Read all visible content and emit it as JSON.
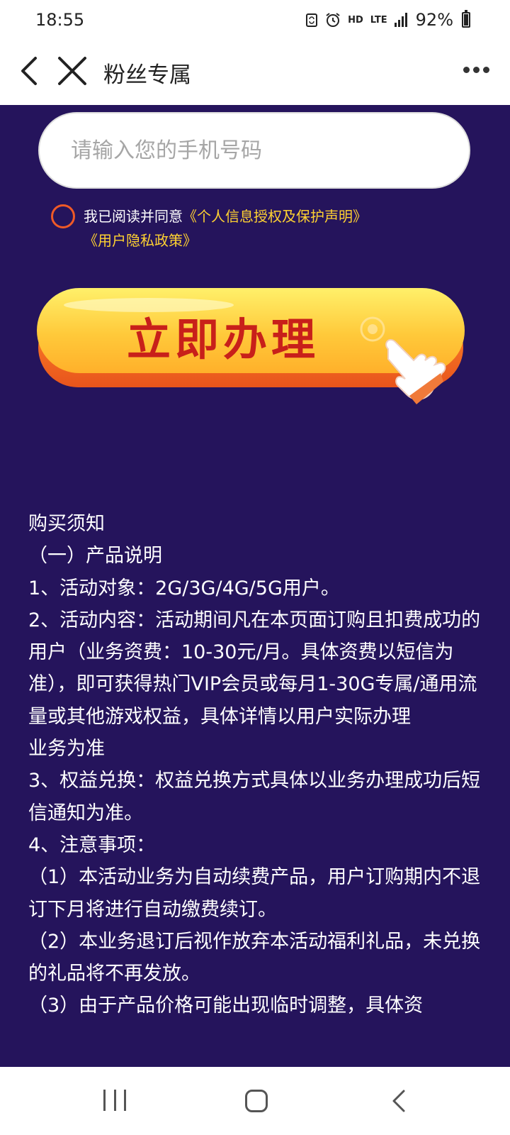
{
  "status_bar": {
    "time": "18:55",
    "network_label": "HD",
    "lte_label": "LTE",
    "battery_percent": "92%"
  },
  "nav": {
    "title": "粉丝专属",
    "icons": [
      "back-arrow-icon",
      "close-icon",
      "more-dots-icon"
    ]
  },
  "form": {
    "phone_placeholder": "请输入您的手机号码",
    "agreement": {
      "prefix": "我已阅读并同意",
      "link1": "《个人信息授权及保护声明》",
      "link2": "《用户隐私政策》",
      "checked": false
    },
    "cta_label": "立即办理"
  },
  "notice": {
    "lines": [
      "购买须知",
      "（一）产品说明",
      "1、活动对象：2G/3G/4G/5G用户。",
      "2、活动内容：活动期间凡在本页面订购且扣费成功的用户（业务资费：10-30元/月。具体资费以短信为准），即可获得热门VIP会员或每月1-30G专属/通用流量或其他游戏权益，具体详情以用户实际办理",
      "业务为准",
      "3、权益兑换：权益兑换方式具体以业务办理成功后短信通知为准。",
      "4、注意事项：",
      "（1）本活动业务为自动续费产品，用户订购期内不退订下月将进行自动缴费续订。",
      "（2）本业务退订后视作放弃本活动福利礼品，未兑换的礼品将不再发放。",
      "（3）由于产品价格可能出现临时调整，具体资"
    ]
  },
  "colors": {
    "page_background": "#25145c",
    "link": "#ffd231",
    "radio_border": "#ef5a27",
    "cta_text": "#c8201a"
  }
}
